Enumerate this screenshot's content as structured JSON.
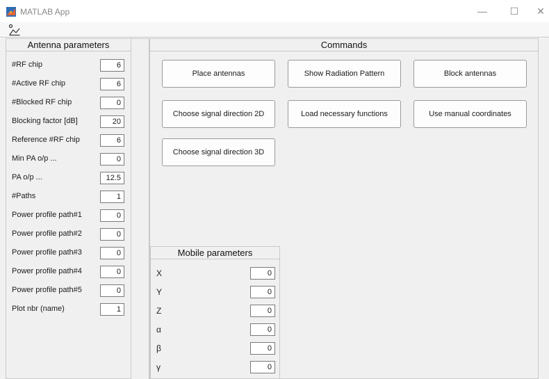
{
  "window": {
    "title": "MATLAB App",
    "minimize": "—",
    "maximize": "☐",
    "close": "✕"
  },
  "antenna": {
    "title": "Antenna parameters",
    "params": [
      {
        "label": "#RF chip",
        "value": "6"
      },
      {
        "label": "#Active RF chip",
        "value": "6"
      },
      {
        "label": "#Blocked RF chip",
        "value": "0"
      },
      {
        "label": "Blocking factor [dB]",
        "value": "20"
      },
      {
        "label": "Reference #RF chip",
        "value": "6"
      },
      {
        "label": "Min PA o/p ...",
        "value": "0"
      },
      {
        "label": "PA o/p ...",
        "value": "12.5"
      },
      {
        "label": "#Paths",
        "value": "1"
      },
      {
        "label": "Power profile path#1",
        "value": "0"
      },
      {
        "label": "Power profile path#2",
        "value": "0"
      },
      {
        "label": "Power profile path#3",
        "value": "0"
      },
      {
        "label": "Power profile path#4",
        "value": "0"
      },
      {
        "label": "Power profile path#5",
        "value": "0"
      },
      {
        "label": "Plot nbr (name)",
        "value": "1"
      }
    ]
  },
  "commands": {
    "title": "Commands",
    "buttons": [
      "Place antennas",
      "Show Radiation Pattern",
      "Block antennas",
      "Choose signal direction 2D",
      "Load necessary functions",
      "Use manual coordinates",
      "Choose signal direction 3D"
    ]
  },
  "mobile": {
    "title": "Mobile parameters",
    "params": [
      {
        "label": "X",
        "value": "0"
      },
      {
        "label": "Y",
        "value": "0"
      },
      {
        "label": "Z",
        "value": "0"
      },
      {
        "label": "α",
        "value": "0"
      },
      {
        "label": "β",
        "value": "0"
      },
      {
        "label": "γ",
        "value": "0"
      }
    ]
  },
  "colors": {
    "panel_bg": "#f0f0f0",
    "border": "#c8c8c8",
    "matlab_orange": "#e16737",
    "matlab_blue": "#2f6db5"
  },
  "icons": {
    "app_logo": "matlab-logo-icon",
    "toolbar": "plot-tool-icon"
  }
}
